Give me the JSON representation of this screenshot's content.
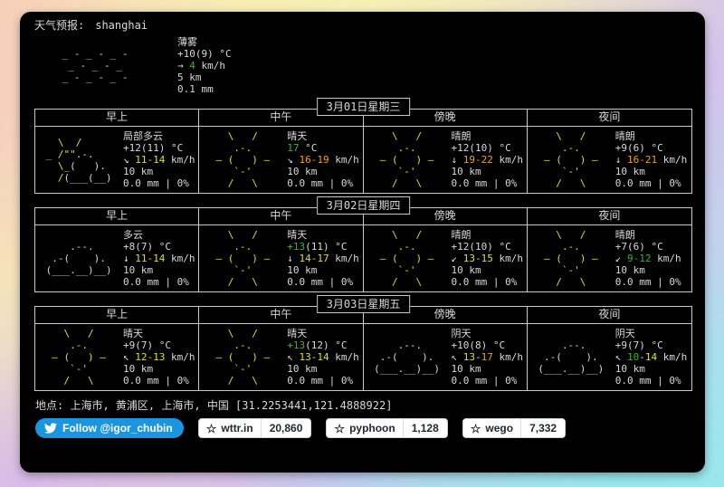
{
  "colors": {
    "terminal_bg": "#000000",
    "fg": "#d9d9d9",
    "cloud": "#d9d9d9",
    "yellow": "#e0e017",
    "orange": "#f0a500",
    "green": "#2eb82e",
    "border": "#c9c9c9",
    "twitter_blue": "#1b95e0"
  },
  "header": {
    "label": "天气预报:",
    "city": "shanghai"
  },
  "period_headers": [
    "早上",
    "中午",
    "傍晚",
    "夜间"
  ],
  "ascii_art": {
    "sunny": [
      [
        [
          "y",
          "    \\   /    "
        ]
      ],
      [
        [
          "y",
          "     .-.     "
        ]
      ],
      [
        [
          "y",
          "  – (   ) –  "
        ]
      ],
      [
        [
          "y",
          "     `-'     "
        ]
      ],
      [
        [
          "y",
          "    /   \\    "
        ]
      ]
    ],
    "partly_cloudy": [
      [
        [
          "y",
          "   \\  /"
        ]
      ],
      [
        [
          "y",
          " _ /\"\""
        ],
        [
          "w",
          ".-."
        ]
      ],
      [
        [
          "y",
          "   \\_"
        ],
        [
          "w",
          "(   )."
        ]
      ],
      [
        [
          "y",
          "   /"
        ],
        [
          "w",
          "(___(__)"
        ]
      ]
    ],
    "cloudy": [
      [
        [
          "w",
          "     .--.    "
        ]
      ],
      [
        [
          "w",
          "  .-(    ).  "
        ]
      ],
      [
        [
          "w",
          " (___.__)__) "
        ]
      ]
    ],
    "mist": [
      [
        [
          "w",
          " _ - _ - _ - "
        ]
      ],
      [
        [
          "w",
          "  _ - _ - _  "
        ]
      ],
      [
        [
          "w",
          " _ - _ - _ - "
        ]
      ]
    ]
  },
  "current": {
    "condition": "薄雾",
    "art": "mist",
    "temp": [
      [
        "f",
        "+10(9) °C"
      ]
    ],
    "wind": [
      [
        "f",
        "→ "
      ],
      [
        "g",
        "4"
      ],
      [
        "f",
        " km/h"
      ]
    ],
    "vis": [
      [
        "f",
        "5 km"
      ]
    ],
    "precip": [
      [
        "f",
        "0.1 mm"
      ]
    ]
  },
  "days": [
    {
      "date": "3月01日星期三",
      "periods": [
        {
          "condition": "局部多云",
          "art": "partly_cloudy",
          "temp": [
            [
              "f",
              "+12(11) °C"
            ]
          ],
          "wind": [
            [
              "f",
              "↘ "
            ],
            [
              "y",
              "11-14"
            ],
            [
              "f",
              " km/h"
            ]
          ],
          "vis": [
            [
              "f",
              "10 km"
            ]
          ],
          "precip": [
            [
              "f",
              "0.0 mm | 0%"
            ]
          ]
        },
        {
          "condition": "晴天",
          "art": "sunny",
          "temp": [
            [
              "g",
              "17"
            ],
            [
              "f",
              " °C"
            ]
          ],
          "wind": [
            [
              "f",
              "↘ "
            ],
            [
              "o",
              "16-19"
            ],
            [
              "f",
              " km/h"
            ]
          ],
          "vis": [
            [
              "f",
              "10 km"
            ]
          ],
          "precip": [
            [
              "f",
              "0.0 mm | 0%"
            ]
          ]
        },
        {
          "condition": "晴朗",
          "art": "sunny",
          "temp": [
            [
              "f",
              "+12(10) °C"
            ]
          ],
          "wind": [
            [
              "f",
              "↓ "
            ],
            [
              "o",
              "19-22"
            ],
            [
              "f",
              " km/h"
            ]
          ],
          "vis": [
            [
              "f",
              "10 km"
            ]
          ],
          "precip": [
            [
              "f",
              "0.0 mm | 0%"
            ]
          ]
        },
        {
          "condition": "晴朗",
          "art": "sunny",
          "temp": [
            [
              "f",
              "+9(6) °C"
            ]
          ],
          "wind": [
            [
              "f",
              "↓ "
            ],
            [
              "o",
              "16-21"
            ],
            [
              "f",
              " km/h"
            ]
          ],
          "vis": [
            [
              "f",
              "10 km"
            ]
          ],
          "precip": [
            [
              "f",
              "0.0 mm | 0%"
            ]
          ]
        }
      ]
    },
    {
      "date": "3月02日星期四",
      "periods": [
        {
          "condition": "多云",
          "art": "cloudy",
          "temp": [
            [
              "f",
              "+8(7) °C"
            ]
          ],
          "wind": [
            [
              "f",
              "↓ "
            ],
            [
              "y",
              "11-14"
            ],
            [
              "f",
              " km/h"
            ]
          ],
          "vis": [
            [
              "f",
              "10 km"
            ]
          ],
          "precip": [
            [
              "f",
              "0.0 mm | 0%"
            ]
          ]
        },
        {
          "condition": "晴天",
          "art": "sunny",
          "temp": [
            [
              "g",
              "+13"
            ],
            [
              "f",
              "(11) °C"
            ]
          ],
          "wind": [
            [
              "f",
              "↓ "
            ],
            [
              "y",
              "14-17"
            ],
            [
              "f",
              " km/h"
            ]
          ],
          "vis": [
            [
              "f",
              "10 km"
            ]
          ],
          "precip": [
            [
              "f",
              "0.0 mm | 0%"
            ]
          ]
        },
        {
          "condition": "晴朗",
          "art": "sunny",
          "temp": [
            [
              "f",
              "+12(10) °C"
            ]
          ],
          "wind": [
            [
              "f",
              "↙ "
            ],
            [
              "y",
              "13-15"
            ],
            [
              "f",
              " km/h"
            ]
          ],
          "vis": [
            [
              "f",
              "10 km"
            ]
          ],
          "precip": [
            [
              "f",
              "0.0 mm | 0%"
            ]
          ]
        },
        {
          "condition": "晴朗",
          "art": "sunny",
          "temp": [
            [
              "f",
              "+7(6) °C"
            ]
          ],
          "wind": [
            [
              "f",
              "↙ "
            ],
            [
              "g",
              "9-12"
            ],
            [
              "f",
              " km/h"
            ]
          ],
          "vis": [
            [
              "f",
              "10 km"
            ]
          ],
          "precip": [
            [
              "f",
              "0.0 mm | 0%"
            ]
          ]
        }
      ]
    },
    {
      "date": "3月03日星期五",
      "periods": [
        {
          "condition": "晴天",
          "art": "sunny",
          "temp": [
            [
              "f",
              "+9(7) °C"
            ]
          ],
          "wind": [
            [
              "f",
              "↖ "
            ],
            [
              "y",
              "12-13"
            ],
            [
              "f",
              " km/h"
            ]
          ],
          "vis": [
            [
              "f",
              "10 km"
            ]
          ],
          "precip": [
            [
              "f",
              "0.0 mm | 0%"
            ]
          ]
        },
        {
          "condition": "晴天",
          "art": "sunny",
          "temp": [
            [
              "g",
              "+13"
            ],
            [
              "f",
              "(12) °C"
            ]
          ],
          "wind": [
            [
              "f",
              "↖ "
            ],
            [
              "y",
              "13-14"
            ],
            [
              "f",
              " km/h"
            ]
          ],
          "vis": [
            [
              "f",
              "10 km"
            ]
          ],
          "precip": [
            [
              "f",
              "0.0 mm | 0%"
            ]
          ]
        },
        {
          "condition": "阴天",
          "art": "cloudy",
          "temp": [
            [
              "f",
              "+10(8) °C"
            ]
          ],
          "wind": [
            [
              "f",
              "↖ "
            ],
            [
              "y",
              "13"
            ],
            [
              "f",
              "-"
            ],
            [
              "o",
              "17"
            ],
            [
              "f",
              " km/h"
            ]
          ],
          "vis": [
            [
              "f",
              "10 km"
            ]
          ],
          "precip": [
            [
              "f",
              "0.0 mm | 0%"
            ]
          ]
        },
        {
          "condition": "阴天",
          "art": "cloudy",
          "temp": [
            [
              "f",
              "+9(7) °C"
            ]
          ],
          "wind": [
            [
              "f",
              "↖ "
            ],
            [
              "g",
              "10"
            ],
            [
              "f",
              "-"
            ],
            [
              "y",
              "14"
            ],
            [
              "f",
              " km/h"
            ]
          ],
          "vis": [
            [
              "f",
              "10 km"
            ]
          ],
          "precip": [
            [
              "f",
              "0.0 mm | 0%"
            ]
          ]
        }
      ]
    }
  ],
  "footer": {
    "location_label": "地点:",
    "location": "上海市, 黄浦区, 上海市, 中国 [31.2253441,121.4888922]"
  },
  "badges": {
    "twitter": {
      "label": "Follow @igor_chubin"
    },
    "star_icon": "☆",
    "github": [
      {
        "name": "wttr.in",
        "count": "20,860"
      },
      {
        "name": "pyphoon",
        "count": "1,128"
      },
      {
        "name": "wego",
        "count": "7,332"
      }
    ]
  }
}
